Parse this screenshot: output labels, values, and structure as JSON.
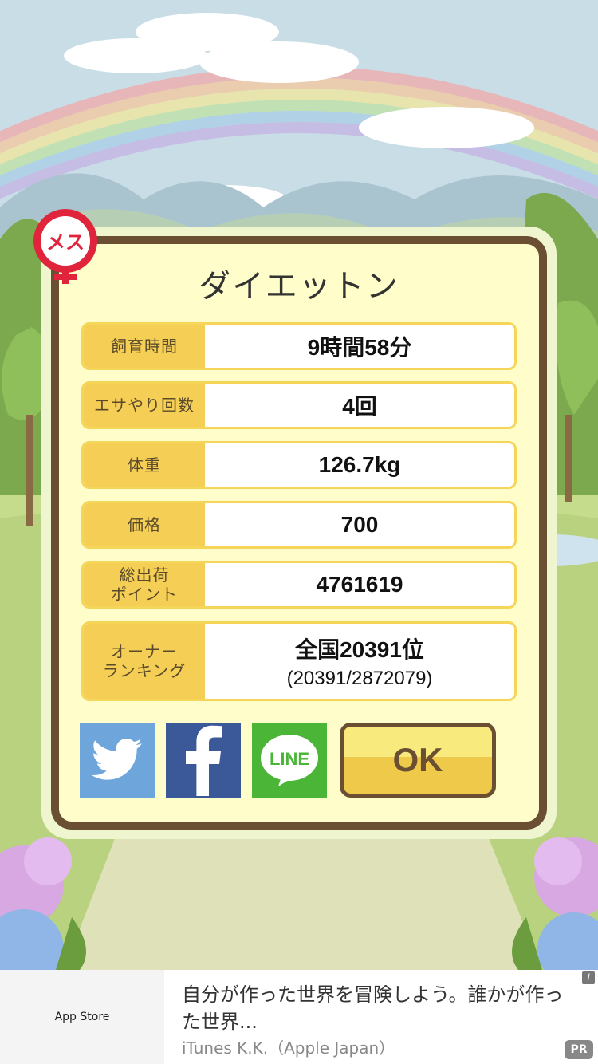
{
  "dialog": {
    "title": "ダイエットン",
    "gender_badge": "メス",
    "rows": [
      {
        "label": "飼育時間",
        "value": "9時間58分"
      },
      {
        "label": "エサやり回数",
        "value": "4回"
      },
      {
        "label": "体重",
        "value": "126.7kg"
      },
      {
        "label": "価格",
        "value": "700"
      },
      {
        "label_line1": "総出荷",
        "label_line2": "ポイント",
        "value": "4761619"
      },
      {
        "label_line1": "オーナー",
        "label_line2": "ランキング",
        "value_main": "全国20391位",
        "value_sub": "(20391/2872079)"
      }
    ],
    "share": {
      "twitter": "twitter-icon",
      "facebook": "facebook-icon",
      "line_label": "LINE"
    },
    "ok_label": "OK"
  },
  "ad": {
    "store_label": " App Store",
    "text": "自分が作った世界を冒険しよう。誰かが作った世界...",
    "advertiser": "iTunes K.K.（Apple Japan）",
    "info_label": "i",
    "pr_label": "PR"
  },
  "colors": {
    "twitter": "#6ea6dc",
    "facebook": "#3b5998",
    "line": "#4bb538",
    "frame": "#6b4f33",
    "label_bg": "#f5cf55"
  }
}
